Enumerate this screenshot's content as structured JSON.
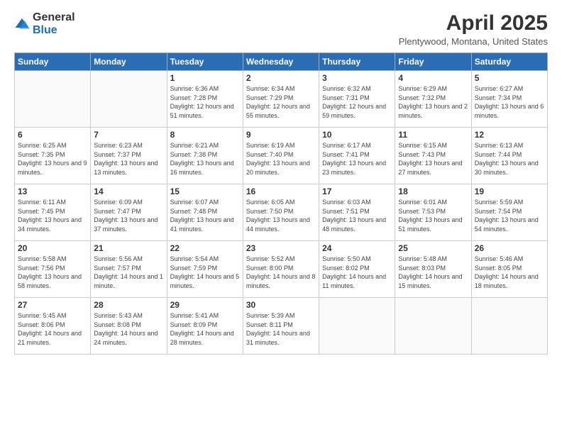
{
  "logo": {
    "general": "General",
    "blue": "Blue"
  },
  "title": "April 2025",
  "subtitle": "Plentywood, Montana, United States",
  "days_of_week": [
    "Sunday",
    "Monday",
    "Tuesday",
    "Wednesday",
    "Thursday",
    "Friday",
    "Saturday"
  ],
  "weeks": [
    [
      {
        "day": "",
        "info": ""
      },
      {
        "day": "",
        "info": ""
      },
      {
        "day": "1",
        "info": "Sunrise: 6:36 AM\nSunset: 7:28 PM\nDaylight: 12 hours and 51 minutes."
      },
      {
        "day": "2",
        "info": "Sunrise: 6:34 AM\nSunset: 7:29 PM\nDaylight: 12 hours and 55 minutes."
      },
      {
        "day": "3",
        "info": "Sunrise: 6:32 AM\nSunset: 7:31 PM\nDaylight: 12 hours and 59 minutes."
      },
      {
        "day": "4",
        "info": "Sunrise: 6:29 AM\nSunset: 7:32 PM\nDaylight: 13 hours and 2 minutes."
      },
      {
        "day": "5",
        "info": "Sunrise: 6:27 AM\nSunset: 7:34 PM\nDaylight: 13 hours and 6 minutes."
      }
    ],
    [
      {
        "day": "6",
        "info": "Sunrise: 6:25 AM\nSunset: 7:35 PM\nDaylight: 13 hours and 9 minutes."
      },
      {
        "day": "7",
        "info": "Sunrise: 6:23 AM\nSunset: 7:37 PM\nDaylight: 13 hours and 13 minutes."
      },
      {
        "day": "8",
        "info": "Sunrise: 6:21 AM\nSunset: 7:38 PM\nDaylight: 13 hours and 16 minutes."
      },
      {
        "day": "9",
        "info": "Sunrise: 6:19 AM\nSunset: 7:40 PM\nDaylight: 13 hours and 20 minutes."
      },
      {
        "day": "10",
        "info": "Sunrise: 6:17 AM\nSunset: 7:41 PM\nDaylight: 13 hours and 23 minutes."
      },
      {
        "day": "11",
        "info": "Sunrise: 6:15 AM\nSunset: 7:43 PM\nDaylight: 13 hours and 27 minutes."
      },
      {
        "day": "12",
        "info": "Sunrise: 6:13 AM\nSunset: 7:44 PM\nDaylight: 13 hours and 30 minutes."
      }
    ],
    [
      {
        "day": "13",
        "info": "Sunrise: 6:11 AM\nSunset: 7:45 PM\nDaylight: 13 hours and 34 minutes."
      },
      {
        "day": "14",
        "info": "Sunrise: 6:09 AM\nSunset: 7:47 PM\nDaylight: 13 hours and 37 minutes."
      },
      {
        "day": "15",
        "info": "Sunrise: 6:07 AM\nSunset: 7:48 PM\nDaylight: 13 hours and 41 minutes."
      },
      {
        "day": "16",
        "info": "Sunrise: 6:05 AM\nSunset: 7:50 PM\nDaylight: 13 hours and 44 minutes."
      },
      {
        "day": "17",
        "info": "Sunrise: 6:03 AM\nSunset: 7:51 PM\nDaylight: 13 hours and 48 minutes."
      },
      {
        "day": "18",
        "info": "Sunrise: 6:01 AM\nSunset: 7:53 PM\nDaylight: 13 hours and 51 minutes."
      },
      {
        "day": "19",
        "info": "Sunrise: 5:59 AM\nSunset: 7:54 PM\nDaylight: 13 hours and 54 minutes."
      }
    ],
    [
      {
        "day": "20",
        "info": "Sunrise: 5:58 AM\nSunset: 7:56 PM\nDaylight: 13 hours and 58 minutes."
      },
      {
        "day": "21",
        "info": "Sunrise: 5:56 AM\nSunset: 7:57 PM\nDaylight: 14 hours and 1 minute."
      },
      {
        "day": "22",
        "info": "Sunrise: 5:54 AM\nSunset: 7:59 PM\nDaylight: 14 hours and 5 minutes."
      },
      {
        "day": "23",
        "info": "Sunrise: 5:52 AM\nSunset: 8:00 PM\nDaylight: 14 hours and 8 minutes."
      },
      {
        "day": "24",
        "info": "Sunrise: 5:50 AM\nSunset: 8:02 PM\nDaylight: 14 hours and 11 minutes."
      },
      {
        "day": "25",
        "info": "Sunrise: 5:48 AM\nSunset: 8:03 PM\nDaylight: 14 hours and 15 minutes."
      },
      {
        "day": "26",
        "info": "Sunrise: 5:46 AM\nSunset: 8:05 PM\nDaylight: 14 hours and 18 minutes."
      }
    ],
    [
      {
        "day": "27",
        "info": "Sunrise: 5:45 AM\nSunset: 8:06 PM\nDaylight: 14 hours and 21 minutes."
      },
      {
        "day": "28",
        "info": "Sunrise: 5:43 AM\nSunset: 8:08 PM\nDaylight: 14 hours and 24 minutes."
      },
      {
        "day": "29",
        "info": "Sunrise: 5:41 AM\nSunset: 8:09 PM\nDaylight: 14 hours and 28 minutes."
      },
      {
        "day": "30",
        "info": "Sunrise: 5:39 AM\nSunset: 8:11 PM\nDaylight: 14 hours and 31 minutes."
      },
      {
        "day": "",
        "info": ""
      },
      {
        "day": "",
        "info": ""
      },
      {
        "day": "",
        "info": ""
      }
    ]
  ]
}
